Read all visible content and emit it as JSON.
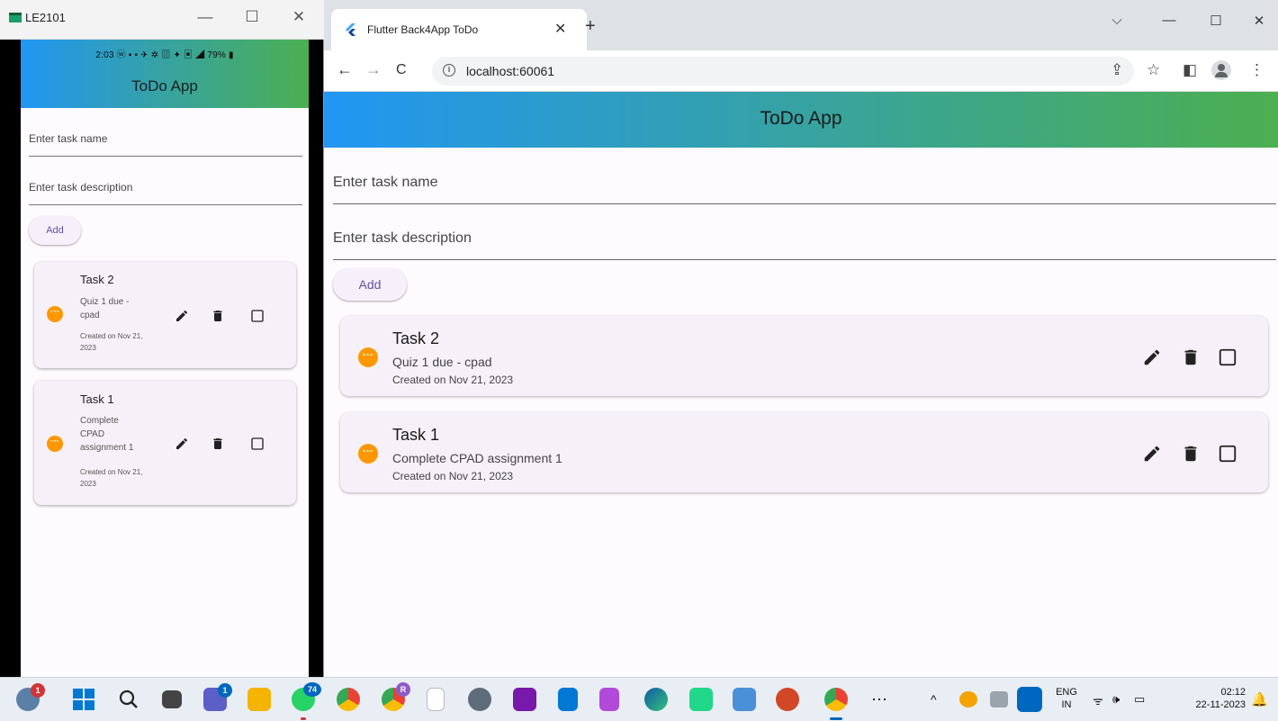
{
  "phone_window": {
    "title": "LE2101",
    "controls": {
      "minimize": "—",
      "maximize": "☐",
      "close": "✕"
    },
    "status_bar": "2:03 ⓦ ▪ •      ✈ ✲ ▥ ✦ ▣ ◢ 79% ▮",
    "app_title": "ToDo App",
    "task_name_placeholder": "Enter task name",
    "task_desc_placeholder": "Enter task description",
    "add_label": "Add",
    "tasks": [
      {
        "title": "Task 2",
        "desc": "Quiz 1 due - cpad",
        "date": "Created on Nov 21, 2023"
      },
      {
        "title": "Task 1",
        "desc": "Complete CPAD assignment 1",
        "date": "Created on Nov 21, 2023"
      }
    ]
  },
  "browser": {
    "tab_title": "Flutter Back4App ToDo",
    "tab_close": "✕",
    "new_tab": "+",
    "window_controls": {
      "dropdown": "⌵",
      "minimize": "—",
      "maximize": "☐",
      "close": "✕"
    },
    "nav": {
      "back": "←",
      "forward": "→",
      "reload": "C"
    },
    "url": "localhost:60061",
    "toolbar_icons": {
      "share": "⇪",
      "star": "☆",
      "sidepanel": "◧",
      "menu": "⋮"
    },
    "app_title": "ToDo App",
    "task_name_placeholder": "Enter task name",
    "task_desc_placeholder": "Enter task description",
    "add_label": "Add",
    "tasks": [
      {
        "title": "Task 2",
        "desc": "Quiz 1 due - cpad",
        "date": "Created on Nov 21, 2023"
      },
      {
        "title": "Task 1",
        "desc": "Complete CPAD assignment 1",
        "date": "Created on Nov 21, 2023"
      }
    ]
  },
  "taskbar": {
    "badges": {
      "weather": "1",
      "teams": "1",
      "whatsapp": "74",
      "chrome_profile": "R"
    },
    "overflow": "⋯",
    "tray": {
      "chevron": "^",
      "lang_top": "ENG",
      "lang_bottom": "IN",
      "time": "02:12",
      "date": "22-11-2023"
    }
  },
  "colors": {
    "accent_orange": "#ff9800",
    "appbar_start": "#2196f3",
    "appbar_end": "#4caf50",
    "button_text": "#6650a4"
  }
}
